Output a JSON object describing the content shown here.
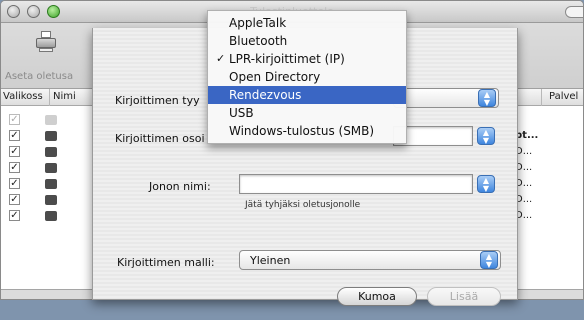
{
  "window": {
    "title": "Tulostinluettelo",
    "toolbar": {
      "set_default_label": "Aseta oletusa"
    },
    "table": {
      "headers": [
        "Valikoss",
        "Nimi",
        "Palvel"
      ],
      "rows": [
        {
          "checked": true,
          "dim": true,
          "trail": ""
        },
        {
          "checked": true,
          "dim": false,
          "trail": "pt..."
        },
        {
          "checked": true,
          "dim": false,
          "trail": "D..."
        },
        {
          "checked": true,
          "dim": false,
          "trail": "D..."
        },
        {
          "checked": true,
          "dim": false,
          "trail": "D..."
        },
        {
          "checked": true,
          "dim": false,
          "trail": "D..."
        },
        {
          "checked": true,
          "dim": false,
          "trail": "D..."
        }
      ]
    }
  },
  "sheet": {
    "printer_type_label": "Kirjoittimen tyy",
    "printer_address_label": "Kirjoittimen osoi",
    "queue_name_label": "Jonon nimi:",
    "queue_name_value": "",
    "queue_hint": "Jätä tyhjäksi oletusjonolle",
    "printer_model_label": "Kirjoittimen malli:",
    "printer_model_value": "Yleinen",
    "cancel_label": "Kumoa",
    "add_label": "Lisää"
  },
  "menu": {
    "items": [
      {
        "label": "AppleTalk",
        "checked": false,
        "selected": false
      },
      {
        "label": "Bluetooth",
        "checked": false,
        "selected": false
      },
      {
        "label": "LPR-kirjoittimet (IP)",
        "checked": true,
        "selected": false
      },
      {
        "label": "Open Directory",
        "checked": false,
        "selected": false
      },
      {
        "label": "Rendezvous",
        "checked": false,
        "selected": true
      },
      {
        "label": "USB",
        "checked": false,
        "selected": false
      },
      {
        "label": "Windows-tulostus (SMB)",
        "checked": false,
        "selected": false
      }
    ]
  },
  "colors": {
    "selection": "#3a66c4",
    "desktop": "#7f94ad",
    "stepper": "#3f86de"
  }
}
